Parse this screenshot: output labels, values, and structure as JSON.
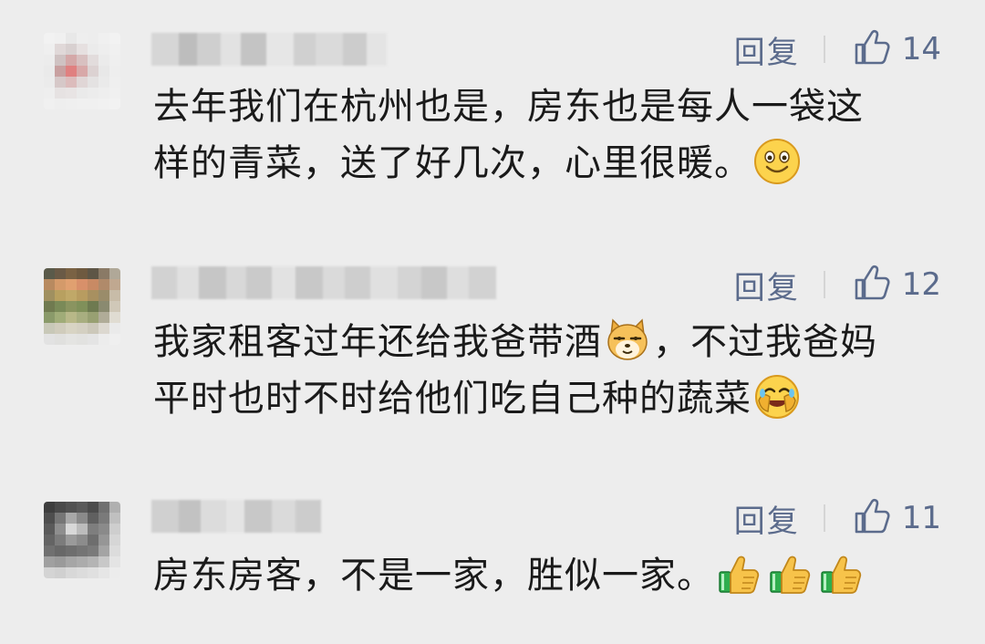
{
  "comments": [
    {
      "reply_label": "回复",
      "like_count": "14",
      "text_line1": "去年我们在杭州也是，房东也是每人一袋这",
      "text_line2": "样的青菜，送了好几次，心里很暖。",
      "emojis": [
        "smile-emoji"
      ]
    },
    {
      "reply_label": "回复",
      "like_count": "12",
      "text_part1": "我家租客过年还给我爸带酒",
      "text_part2": "，不过我爸妈",
      "text_line2": "平时也时不时给他们吃自己种的蔬菜",
      "emojis": [
        "doge-emoji",
        "facepalm-laugh-emoji"
      ]
    },
    {
      "reply_label": "回复",
      "like_count": "11",
      "text_line1": "房东房客，不是一家，胜似一家。",
      "emojis": [
        "thumbs-up-emoji",
        "thumbs-up-emoji",
        "thumbs-up-emoji"
      ]
    }
  ],
  "colors": {
    "background": "#ededed",
    "action_text": "#5b6b8c",
    "body_text": "#1a1a1a"
  }
}
